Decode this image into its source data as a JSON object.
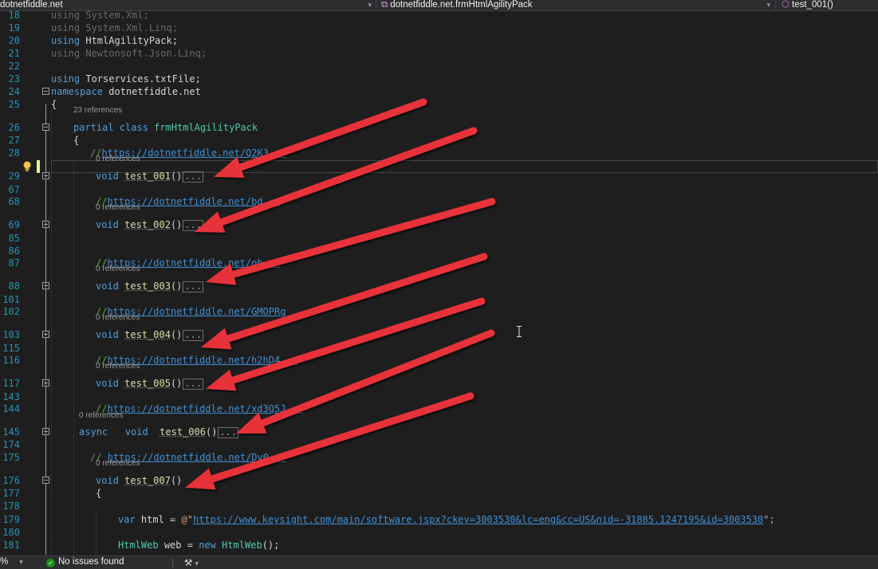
{
  "navbar": {
    "project": "dotnetfiddle.net",
    "class_path": "dotnetfiddle.net.frmHtmlAgilityPack",
    "member": "test_001()"
  },
  "lines": [
    {
      "n": "18",
      "using": "using",
      "ns": "System.Xml;",
      "dim": true
    },
    {
      "n": "19",
      "using": "using",
      "ns": "System.Xml.Linq;",
      "dim": true
    },
    {
      "n": "20",
      "using": "using",
      "ns": "HtmlAgilityPack;",
      "dim": false
    },
    {
      "n": "21",
      "using": "using",
      "ns": "Newtonsoft.Json.Linq;",
      "dim": true
    },
    {
      "n": "22"
    },
    {
      "n": "23",
      "using": "using",
      "ns": "Torservices.txtFile;",
      "dim": false
    },
    {
      "n": "24",
      "kw": "namespace",
      "name": "dotnetfiddle.net"
    },
    {
      "n": "25",
      "brace": "{"
    },
    {
      "n": "26",
      "lens": "23 references",
      "kw1": "partial",
      "kw2": "class",
      "name": "frmHtmlAgilityPack"
    },
    {
      "n": "27",
      "brace": "{"
    },
    {
      "n": "28",
      "comment": "//",
      "url": "https://dotnetfiddle.net/Q2K3..."
    },
    {
      "n": "29",
      "lens": "0 references",
      "void": "void",
      "method": "test_001",
      "paren": "()",
      "collapsed": "..."
    },
    {
      "n": "67"
    },
    {
      "n": "68",
      "comment": "//",
      "url": "https://dotnetfiddle.net/bd..."
    },
    {
      "n": "69",
      "lens": "0 references",
      "void": "void",
      "method": "test_002",
      "paren": "()",
      "collapsed": "..."
    },
    {
      "n": "85"
    },
    {
      "n": "86"
    },
    {
      "n": "87",
      "comment": "//",
      "url": "https://dotnetfiddle.net/oh..."
    },
    {
      "n": "88",
      "lens": "0 references",
      "void": "void",
      "method": "test_003",
      "paren": "()",
      "collapsed": "..."
    },
    {
      "n": "101"
    },
    {
      "n": "102",
      "comment": "//",
      "url": "https://dotnetfiddle.net/GMOPRg"
    },
    {
      "n": "103",
      "lens": "0 references",
      "void": "void",
      "method": "test_004",
      "paren": "()",
      "collapsed": "..."
    },
    {
      "n": "115"
    },
    {
      "n": "116",
      "comment": "//",
      "url": "https://dotnetfiddle.net/h2hD4..."
    },
    {
      "n": "117",
      "lens": "0 references",
      "void": "void",
      "method": "test_005",
      "paren": "()",
      "collapsed": "..."
    },
    {
      "n": "143"
    },
    {
      "n": "144",
      "comment": "//",
      "url": "https://dotnetfiddle.net/xd3Q5J..."
    },
    {
      "n": "145",
      "lens": "0 references",
      "async": "async",
      "void": "void",
      "method": "test_006",
      "paren": "()",
      "collapsed": "..."
    },
    {
      "n": "174"
    },
    {
      "n": "175",
      "comment": "// ",
      "url": "https://dotnetfiddle.net/Dv0..."
    },
    {
      "n": "176",
      "lens": "0 references",
      "void": "void",
      "method": "test_007",
      "paren": "()"
    },
    {
      "n": "177",
      "brace": "{"
    },
    {
      "n": "178"
    },
    {
      "n": "179",
      "var": "var",
      "ident": "html",
      "eq": " = ",
      "str_prefix": "@\"",
      "str_url": "https://www.keysight.com/main/software.jspx?ckey=3003530&lc=eng&cc=US&nid=-31885.1247195&id=3003530",
      "str_suffix": "\";"
    },
    {
      "n": "180"
    },
    {
      "n": "181",
      "type": "HtmlWeb",
      "ident": "web",
      "eq": " = ",
      "new": "new",
      "ctor": "HtmlWeb",
      "tail": "();"
    }
  ],
  "status": {
    "zoom": "%",
    "issues": "No issues found"
  },
  "icons": [
    "lightbulb-icon",
    "fold-minus-icon",
    "fold-plus-icon",
    "check-circle-icon",
    "brush-icon",
    "text-cursor-icon",
    "class-member-icon"
  ],
  "colors": {
    "keyword": "#569cd6",
    "type": "#4ec9b0",
    "method": "#dcdcaa",
    "comment": "#57a64a",
    "link": "#3f8fd6",
    "string": "#d69d85",
    "linenumber": "#2b91af",
    "arrow": "#e8323a",
    "background": "#1e1e1e"
  }
}
